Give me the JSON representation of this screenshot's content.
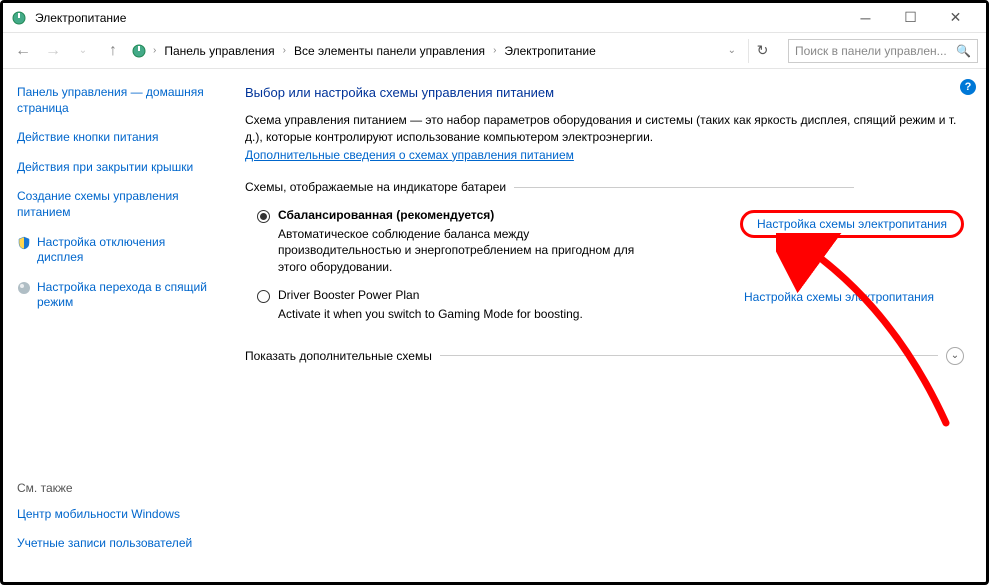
{
  "window": {
    "title": "Электропитание"
  },
  "breadcrumb": {
    "items": [
      "Панель управления",
      "Все элементы панели управления",
      "Электропитание"
    ]
  },
  "search": {
    "placeholder": "Поиск в панели управлен..."
  },
  "sidebar": {
    "home": "Панель управления — домашняя страница",
    "links": [
      "Действие кнопки питания",
      "Действия при закрытии крышки",
      "Создание схемы управления питанием"
    ],
    "linkShield": "Настройка отключения дисплея",
    "linkOrb": "Настройка перехода в спящий режим",
    "seealso": "См. также",
    "bottom": [
      "Центр мобильности Windows",
      "Учетные записи пользователей"
    ]
  },
  "main": {
    "heading": "Выбор или настройка схемы управления питанием",
    "desc": "Схема управления питанием — это набор параметров оборудования и системы (таких как яркость дисплея, спящий режим и т. д.), которые контролируют использование компьютером электроэнергии.",
    "more": "Дополнительные сведения о схемах управления питанием",
    "section1": "Схемы, отображаемые на индикаторе батареи",
    "plan1": {
      "name": "Сбалансированная (рекомендуется)",
      "desc": "Автоматическое соблюдение баланса между производительностью и энергопотреблением на пригодном для этого оборудовании.",
      "link": "Настройка схемы электропитания"
    },
    "plan2": {
      "name": "Driver Booster Power Plan",
      "desc": "Activate it when you switch to Gaming Mode for boosting.",
      "link": "Настройка схемы электропитания"
    },
    "showmore": "Показать дополнительные схемы"
  }
}
